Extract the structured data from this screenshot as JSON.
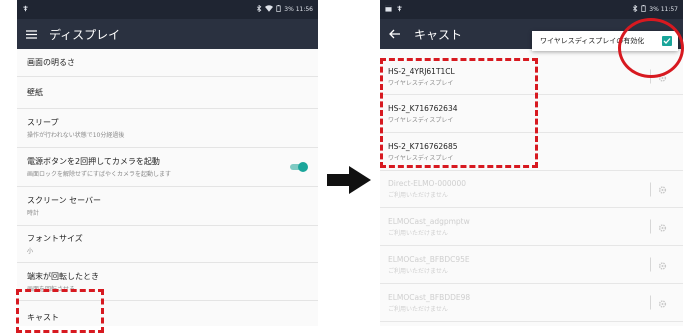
{
  "left": {
    "status_time": "3% 11:56",
    "header_title": "ディスプレイ",
    "settings": [
      {
        "title": "画面の明るさ",
        "subtitle": ""
      },
      {
        "title": "壁紙",
        "subtitle": ""
      },
      {
        "title": "スリープ",
        "subtitle": "操作が行われない状態で10分経過後"
      },
      {
        "title": "電源ボタンを2回押してカメラを起動",
        "subtitle": "画面ロックを解除せずにすばやくカメラを起動します"
      },
      {
        "title": "スクリーン セーバー",
        "subtitle": "時計"
      },
      {
        "title": "フォントサイズ",
        "subtitle": "小"
      },
      {
        "title": "端末が回転したとき",
        "subtitle": "画面を回転させる"
      },
      {
        "title": "キャスト",
        "subtitle": ""
      }
    ]
  },
  "right": {
    "status_time": "3% 11:57",
    "header_title": "キャスト",
    "menu_item": "ワイヤレスディスプレイの有効化",
    "devices": [
      {
        "name": "HS-2_4YRJ61T1CL",
        "status": "ワイヤレスディスプレイ"
      },
      {
        "name": "HS-2_K716762634",
        "status": "ワイヤレスディスプレイ"
      },
      {
        "name": "HS-2_K716762685",
        "status": "ワイヤレスディスプレイ"
      },
      {
        "name": "Direct-ELMO-000000",
        "status": "ご利用いただけません"
      },
      {
        "name": "ELMOCast_adgpmptw",
        "status": "ご利用いただけません"
      },
      {
        "name": "ELMOCast_BFBDC95E",
        "status": "ご利用いただけません"
      },
      {
        "name": "ELMOCast_BFBDDE98",
        "status": "ご利用いただけません"
      }
    ]
  },
  "colors": {
    "status_bar": "#1f2532",
    "app_bar": "#2a3140",
    "accent": "#1aa59a",
    "highlight": "#d71920"
  }
}
